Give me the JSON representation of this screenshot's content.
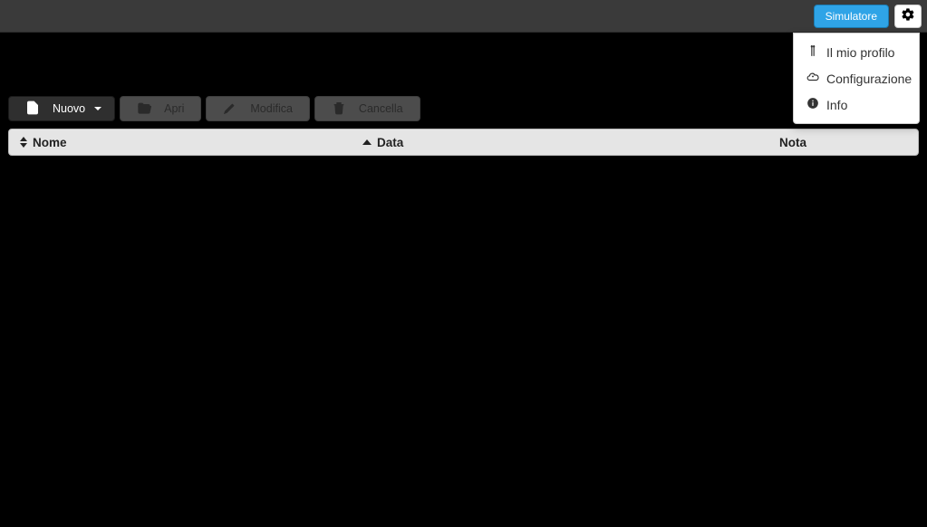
{
  "topbar": {
    "simulator_label": "Simulatore"
  },
  "dropdown": {
    "profile_label": "Il mio profilo",
    "config_label": "Configurazione",
    "info_label": "Info"
  },
  "toolbar": {
    "new_label": "Nuovo",
    "open_label": "Apri",
    "edit_label": "Modifica",
    "delete_label": "Cancella"
  },
  "table": {
    "col_name": "Nome",
    "col_date": "Data",
    "col_note": "Nota",
    "rows": []
  }
}
